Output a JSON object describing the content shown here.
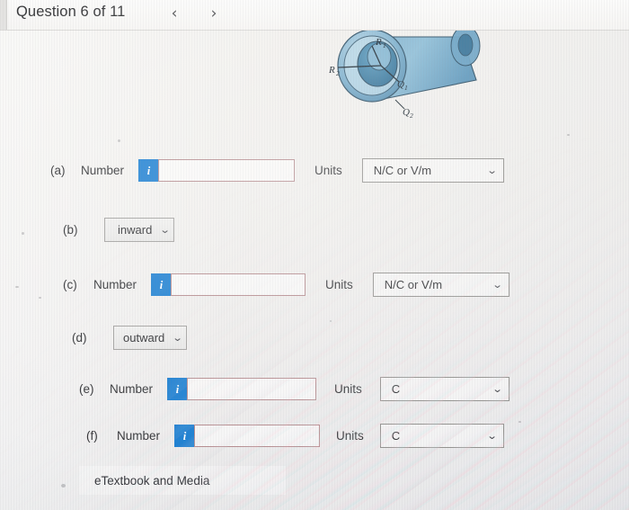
{
  "header": {
    "question_title": "Question 6 of 11",
    "prev_icon": "chevron-left-icon",
    "next_icon": "chevron-right-icon",
    "prev_glyph": "‹",
    "next_glyph": "›"
  },
  "figure": {
    "description": "coaxial-cylinder-diagram",
    "labels": {
      "inner_radius": "R₁",
      "outer_radius": "R₂",
      "inner_charge": "Q₁",
      "outer_charge": "Q₂"
    },
    "colors": {
      "shell_light": "#9fc8dd",
      "shell_mid": "#6ba3c4",
      "shell_dark": "#3f7fa6",
      "outline": "#2b4d63"
    }
  },
  "form": {
    "number_label": "Number",
    "units_label": "Units",
    "info_badge_glyph": "i",
    "caret_glyph": "⌄",
    "rows": [
      {
        "id": "a",
        "part": "(a)",
        "type": "number-units",
        "value": "",
        "placeholder": "",
        "units_value": "N/C or V/m"
      },
      {
        "id": "b",
        "part": "(b)",
        "type": "select",
        "select_value": "inward"
      },
      {
        "id": "c",
        "part": "(c)",
        "type": "number-units",
        "value": "",
        "placeholder": "",
        "units_value": "N/C or V/m"
      },
      {
        "id": "d",
        "part": "(d)",
        "type": "select",
        "select_value": "outward"
      },
      {
        "id": "e",
        "part": "(e)",
        "type": "number-units",
        "value": "",
        "placeholder": "",
        "units_value": "C"
      },
      {
        "id": "f",
        "part": "(f)",
        "type": "number-units",
        "value": "",
        "placeholder": "",
        "units_value": "C"
      }
    ]
  },
  "footer": {
    "etextbook_label": "eTextbook and Media"
  }
}
